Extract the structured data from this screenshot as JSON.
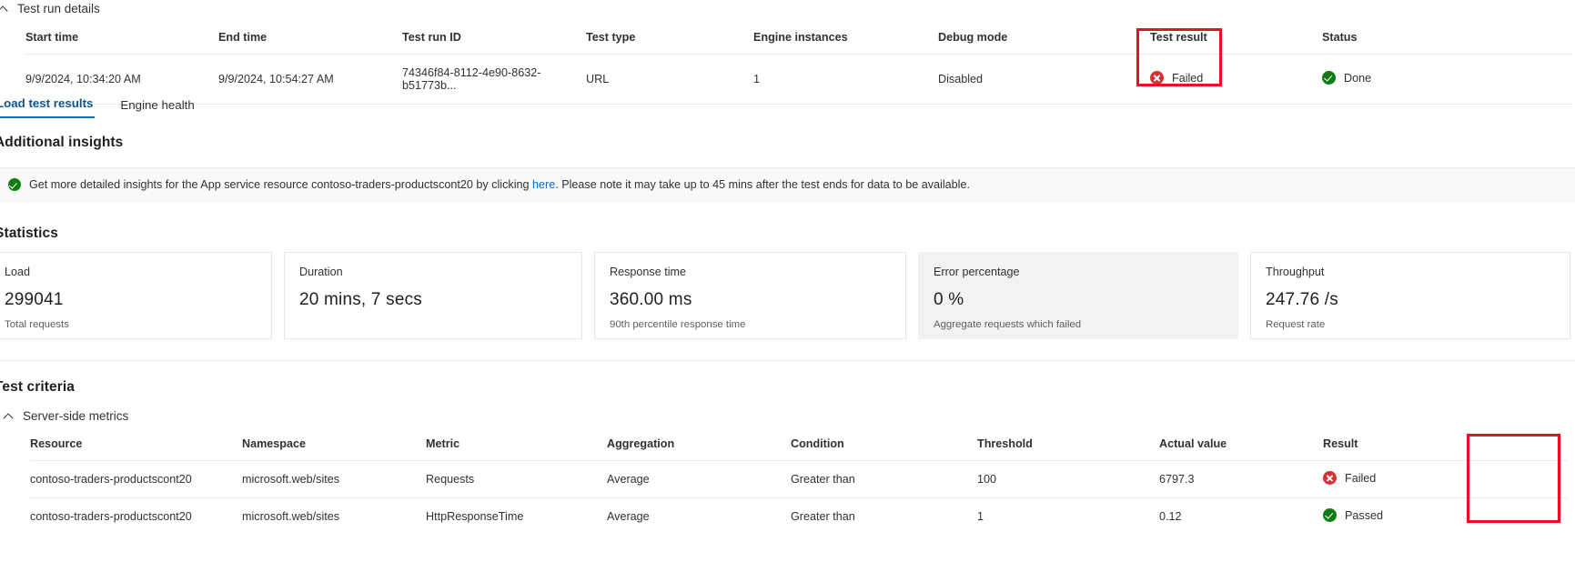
{
  "details_section": {
    "title": "Test run details",
    "collapse_icon": "chevron-up-icon",
    "columns": [
      "Start time",
      "End time",
      "Test run ID",
      "Test type",
      "Engine instances",
      "Debug mode",
      "Test result",
      "Status"
    ],
    "rows": [
      {
        "start_time": "9/9/2024, 10:34:20 AM",
        "end_time": "9/9/2024, 10:54:27 AM",
        "test_run_id": "74346f84-8112-4e90-8632-b51773b...",
        "test_type": "URL",
        "engine_instances": "1",
        "debug_mode": "Disabled",
        "test_result": "Failed",
        "test_result_icon": "error-circle-icon",
        "status": "Done",
        "status_icon": "success-circle-icon"
      }
    ]
  },
  "tabs": [
    {
      "label": "Load test results",
      "active": true
    },
    {
      "label": "Engine health",
      "active": false
    }
  ],
  "insights": {
    "heading": "Additional insights",
    "banner_icon": "success-circle-icon",
    "text_before": "Get more detailed insights for the App service resource contoso-traders-productscont20 by clicking ",
    "link_text": "here",
    "text_after": ". Please note it may take up to 45 mins after the test ends for data to be available."
  },
  "statistics": {
    "heading": "Statistics",
    "cards": [
      {
        "title": "Load",
        "value": "299041",
        "subtitle": "Total requests",
        "highlighted": false
      },
      {
        "title": "Duration",
        "value": "20 mins, 7 secs",
        "subtitle": "",
        "highlighted": false
      },
      {
        "title": "Response time",
        "value": "360.00 ms",
        "subtitle": "90th percentile response time",
        "highlighted": false
      },
      {
        "title": "Error percentage",
        "value": "0 %",
        "subtitle": "Aggregate requests which failed",
        "highlighted": true
      },
      {
        "title": "Throughput",
        "value": "247.76 /s",
        "subtitle": "Request rate",
        "highlighted": false
      }
    ]
  },
  "test_criteria": {
    "heading": "Test criteria",
    "group_label": "Server-side metrics",
    "group_collapse_icon": "chevron-up-icon",
    "columns": [
      "Resource",
      "Namespace",
      "Metric",
      "Aggregation",
      "Condition",
      "Threshold",
      "Actual value",
      "Result"
    ],
    "rows": [
      {
        "resource": "contoso-traders-productscont20",
        "namespace": "microsoft.web/sites",
        "metric": "Requests",
        "aggregation": "Average",
        "condition": "Greater than",
        "threshold": "100",
        "actual_value": "6797.3",
        "result": "Failed",
        "result_icon": "error-circle-icon"
      },
      {
        "resource": "contoso-traders-productscont20",
        "namespace": "microsoft.web/sites",
        "metric": "HttpResponseTime",
        "aggregation": "Average",
        "condition": "Greater than",
        "threshold": "1",
        "actual_value": "0.12",
        "result": "Passed",
        "result_icon": "success-circle-icon"
      }
    ]
  },
  "annotations": {
    "test_result_highlight_color": "#e81123",
    "result_highlight_color": "#e81123"
  },
  "colors": {
    "accent": "#0f6cbd",
    "fail": "#d13438",
    "pass": "#107c10",
    "link": "#0f6cbd",
    "highlight": "#e81123"
  }
}
